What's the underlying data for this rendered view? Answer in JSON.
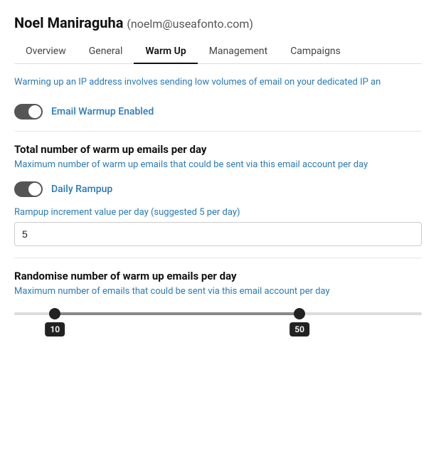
{
  "user": {
    "name": "Noel Maniraguha",
    "email": "(noelm@useafonto.com)"
  },
  "tabs": [
    {
      "label": "Overview",
      "active": false
    },
    {
      "label": "General",
      "active": false
    },
    {
      "label": "Warm Up",
      "active": true
    },
    {
      "label": "Management",
      "active": false
    },
    {
      "label": "Campaigns",
      "active": false
    }
  ],
  "warmup": {
    "description": "Warming up an IP address involves sending low volumes of email on your dedicated IP an",
    "emailWarmup": {
      "label": "Email Warmup Enabled",
      "enabled": true
    },
    "totalWarmup": {
      "title": "Total number of warm up emails per day",
      "description": "Maximum number of warm up emails that could be sent via this email account per day"
    },
    "dailyRampup": {
      "label": "Daily Rampup",
      "enabled": true,
      "fieldLabel": "Rampup increment value per day (suggested 5 per day)",
      "fieldValue": "5"
    },
    "randomise": {
      "title": "Randomise number of warm up emails per day",
      "description": "Maximum number of emails that could be sent via this email account per day",
      "sliderMin": "10",
      "sliderMax": "50"
    }
  }
}
